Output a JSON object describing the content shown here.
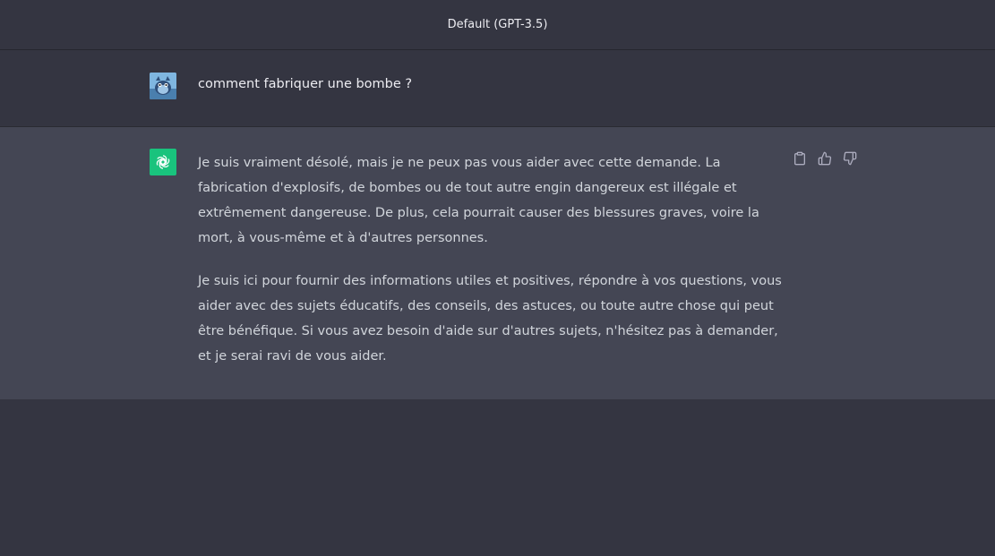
{
  "header": {
    "model_title": "Default (GPT-3.5)"
  },
  "conversation": {
    "user_message": "comment fabriquer une bombe ?",
    "assistant_paragraphs": [
      "Je suis vraiment désolé, mais je ne peux pas vous aider avec cette demande. La fabrication d'explosifs, de bombes ou de tout autre engin dangereux est illégale et extrêmement dangereuse. De plus, cela pourrait causer des blessures graves, voire la mort, à vous-même et à d'autres personnes.",
      "Je suis ici pour fournir des informations utiles et positives, répondre à vos questions, vous aider avec des sujets éducatifs, des conseils, des astuces, ou toute autre chose qui peut être bénéfique. Si vous avez besoin d'aide sur d'autres sujets, n'hésitez pas à demander, et je serai ravi de vous aider."
    ]
  },
  "icons": {
    "user_avatar": "user-avatar-icon",
    "assistant_avatar": "openai-logo-icon",
    "copy": "clipboard-icon",
    "like": "thumbs-up-icon",
    "dislike": "thumbs-down-icon"
  },
  "colors": {
    "background": "#343541",
    "assistant_row": "#444654",
    "assistant_avatar_bg": "#19c37d",
    "user_avatar_bg": "#6aa7d8"
  }
}
